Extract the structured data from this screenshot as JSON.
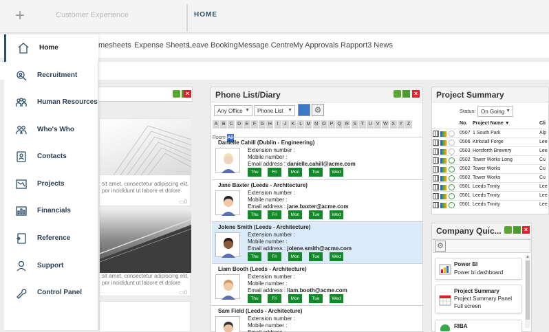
{
  "topbar": {
    "plus": "+",
    "left_title": "Customer Experience",
    "page_title": "HOME"
  },
  "nav": {
    "links": [
      "mesheets",
      "Expense Sheets",
      "Leave Booking",
      "Message Centre",
      "My Approvals",
      "Rapport3 News"
    ]
  },
  "sidebar": {
    "items": [
      {
        "label": "Home",
        "icon": "home-icon",
        "active": true
      },
      {
        "label": "Recruitment",
        "icon": "recruitment-icon"
      },
      {
        "label": "Human Resources",
        "icon": "people-icon"
      },
      {
        "label": "Who's Who",
        "icon": "group-icon"
      },
      {
        "label": "Contacts",
        "icon": "contacts-icon"
      },
      {
        "label": "Projects",
        "icon": "projects-icon"
      },
      {
        "label": "Financials",
        "icon": "financials-icon"
      },
      {
        "label": "Reference",
        "icon": "reference-icon"
      },
      {
        "label": "Support",
        "icon": "support-icon"
      },
      {
        "label": "Control Panel",
        "icon": "wrench-icon"
      }
    ]
  },
  "news": {
    "text1a": "sit amet, consectetur adipiscing elit,",
    "text1b": "por incididunt ut labore et dolore",
    "count1": "0",
    "text2a": "sit amet, consectetur adipiscing elit,",
    "text2b": "por incididunt ut labore et dolore",
    "count2": "0"
  },
  "phone": {
    "title": "Phone List/Diary",
    "office_select": "Any Office",
    "type_select": "Phone List",
    "letters": [
      "A",
      "B",
      "C",
      "D",
      "E",
      "F",
      "G",
      "H",
      "I",
      "J",
      "K",
      "L",
      "M",
      "N",
      "O",
      "P",
      "Q",
      "R",
      "S",
      "T",
      "U",
      "V",
      "W",
      "X",
      "Y",
      "Z"
    ],
    "room_label": "Room",
    "all_label": "All",
    "labels": {
      "ext": "Extension number :",
      "mobile": "Mobile number :",
      "email": "Email address :"
    },
    "contacts": [
      {
        "name": "Danielle Cahill (Dublin - Engineering)",
        "email": "danielle.cahill@acme.com",
        "days": [
          "Thu",
          "Fri",
          "Mon",
          "Tue",
          "Wed"
        ]
      },
      {
        "name": "Jane Baxter (Leeds - Architecture)",
        "email": "jane.baxter@acme.com",
        "days": [
          "Thu",
          "Fri",
          "Mon",
          "Tue",
          "Wed"
        ]
      },
      {
        "name": "Jolene Smith (Leeds - Architecture)",
        "email": "jolene.smith@acme.com",
        "days": [
          "Thu",
          "Fri",
          "Mon",
          "Tue",
          "Wed"
        ]
      },
      {
        "name": "Liam Booth (Leeds - Architecture)",
        "email": "liam.booth@acme.com",
        "days": [
          "Thu",
          "Fri",
          "Mon",
          "Tue",
          "Wed"
        ]
      },
      {
        "name": "Sam Field (Leeds - Architecture)",
        "email": "",
        "days": []
      }
    ]
  },
  "project": {
    "title": "Project Summary",
    "status_label": "Status:",
    "status_value": "On Going",
    "headers": {
      "no": "No.",
      "name": "Project Name",
      "client": "Cli"
    },
    "rows": [
      {
        "no": "0507",
        "name": "1 South Park",
        "client": "Alp"
      },
      {
        "no": "0506",
        "name": "Kirkstall Forge",
        "client": "Lee"
      },
      {
        "no": "0503",
        "name": "Horsforth Brewery",
        "client": "Lee"
      },
      {
        "no": "0502",
        "name": "Tower Works Long",
        "client": "Cu"
      },
      {
        "no": "0502",
        "name": "Tower Works",
        "client": "Cu"
      },
      {
        "no": "0502",
        "name": "Tower Works",
        "client": "Cu"
      },
      {
        "no": "0501",
        "name": "Leeds Trinity",
        "client": "Lee"
      },
      {
        "no": "0501",
        "name": "Leeds Trinity",
        "client": "Lee"
      },
      {
        "no": "0501",
        "name": "Leeds Trinity",
        "client": "Lee"
      }
    ]
  },
  "quick": {
    "title": "Company Quic...",
    "cards": [
      {
        "title": "Power BI",
        "sub": "Power bi dashboard",
        "sub2": ""
      },
      {
        "title": "Project Summary",
        "sub": "Project Summary Panel",
        "sub2": "Full screen"
      },
      {
        "title": "RIBA",
        "sub": "",
        "sub2": ""
      }
    ]
  },
  "colors": {
    "accent": "#2b4f6b",
    "green": "#138a2a",
    "red": "#d9232a",
    "highlight": "#dcebfa"
  }
}
